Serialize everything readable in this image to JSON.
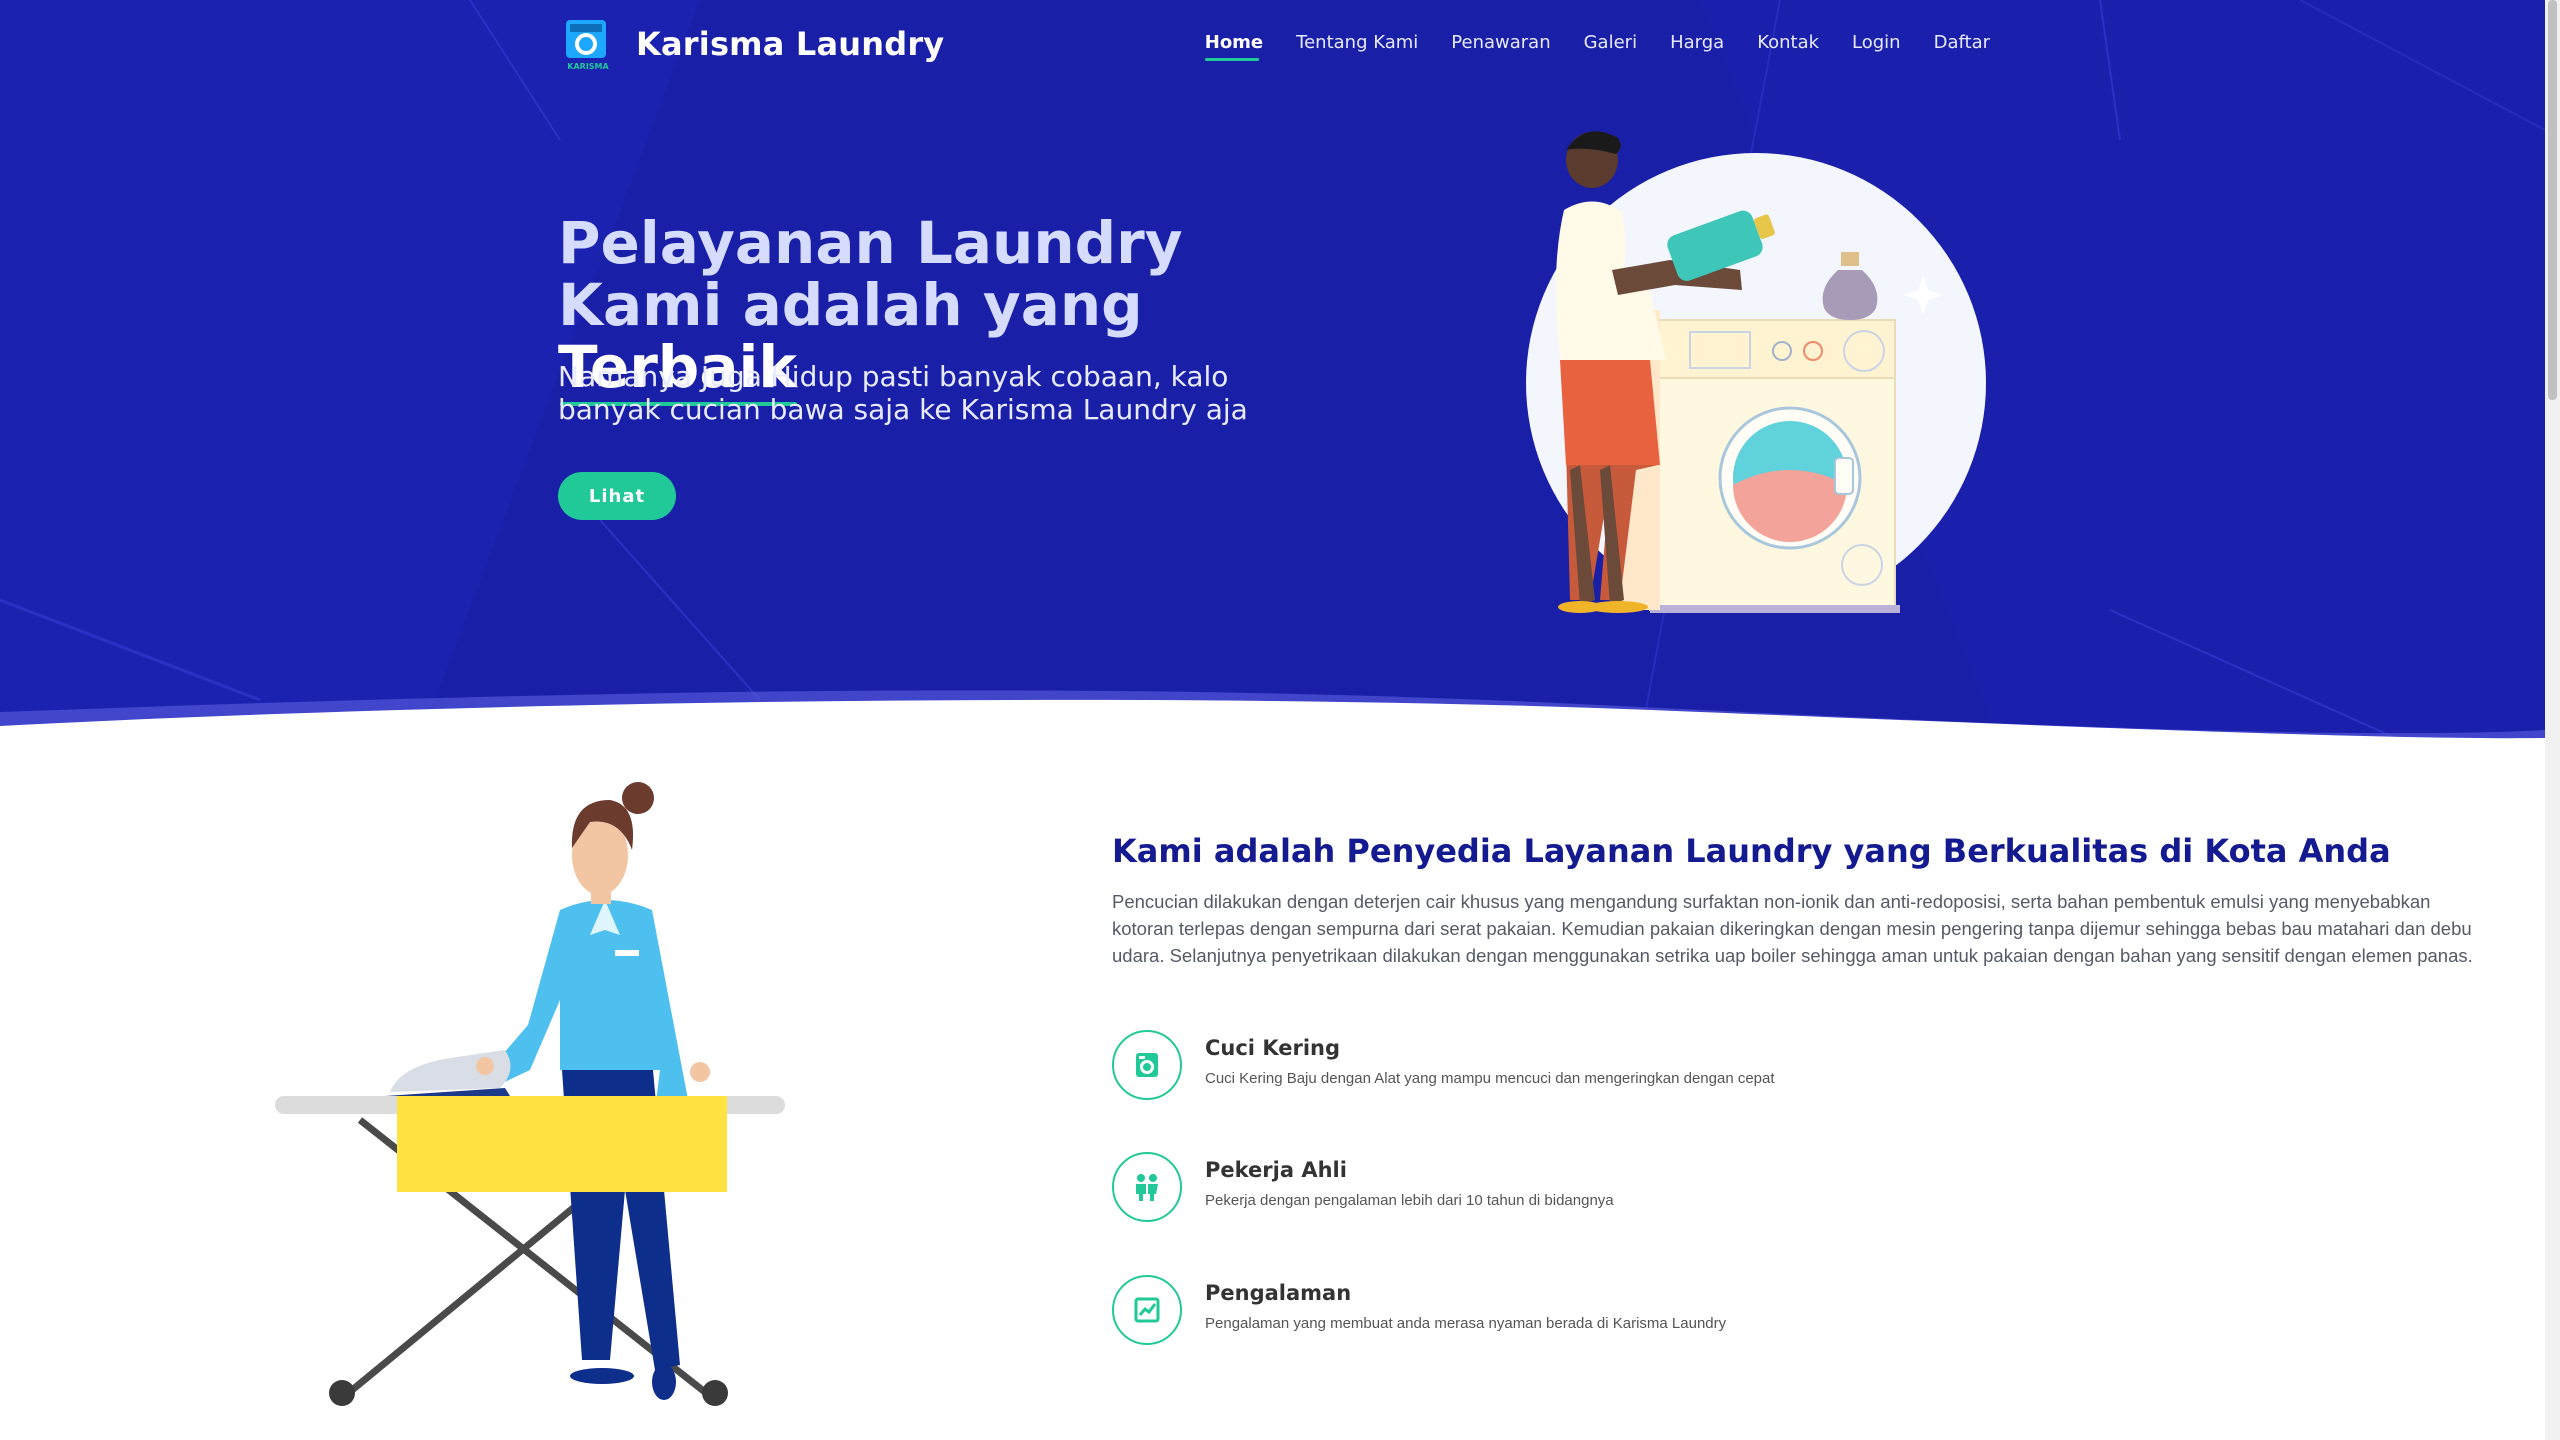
{
  "brand": {
    "name": "Karisma Laundry",
    "logo_text": "KARISMA"
  },
  "nav": {
    "items": [
      {
        "label": "Home",
        "active": true
      },
      {
        "label": "Tentang Kami"
      },
      {
        "label": "Penawaran"
      },
      {
        "label": "Galeri"
      },
      {
        "label": "Harga"
      },
      {
        "label": "Kontak"
      },
      {
        "label": "Login"
      },
      {
        "label": "Daftar"
      }
    ]
  },
  "hero": {
    "title_part1": "Pelayanan Laundry Kami adalah yang ",
    "title_highlight": "Terbaik",
    "subtitle": "Namanya Juga Hidup pasti banyak cobaan, kalo banyak cucian bawa saja ke Karisma Laundry aja",
    "button_label": "Lihat"
  },
  "about": {
    "title": "Kami adalah Penyedia Layanan Laundry yang Berkualitas di Kota Anda",
    "text": "Pencucian dilakukan dengan deterjen cair khusus yang mengandung surfaktan non-ionik dan anti-redoposisi, serta bahan pembentuk emulsi yang menyebabkan kotoran terlepas dengan sempurna dari serat pakaian. Kemudian pakaian dikeringkan dengan mesin pengering tanpa dijemur sehingga bebas bau matahari dan debu udara. Selanjutnya penyetrikaan dilakukan dengan menggunakan setrika uap boiler sehingga aman untuk pakaian dengan bahan yang sensitif dengan elemen panas.",
    "features": [
      {
        "title": "Cuci Kering",
        "desc": "Cuci Kering Baju dengan Alat yang mampu mencuci dan mengeringkan dengan cepat",
        "icon": "washing-machine-icon"
      },
      {
        "title": "Pekerja Ahli",
        "desc": "Pekerja dengan pengalaman lebih dari 10 tahun di bidangnya",
        "icon": "people-icon"
      },
      {
        "title": "Pengalaman",
        "desc": "Pengalaman yang membuat anda merasa nyaman berada di Karisma Laundry",
        "icon": "chart-icon"
      }
    ]
  },
  "colors": {
    "hero_bg": "#1a1fa8",
    "accent": "#20c997",
    "title_blue": "#141a8f"
  }
}
